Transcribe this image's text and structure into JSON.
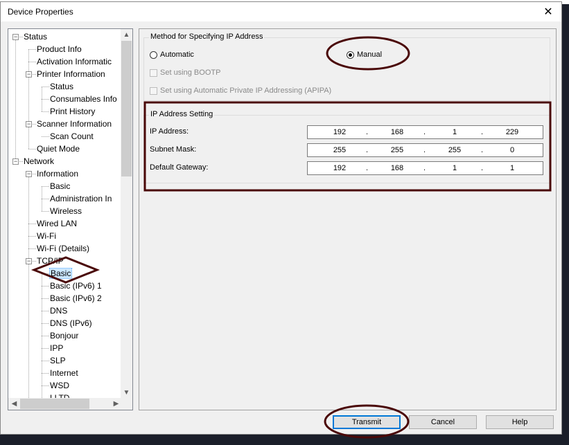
{
  "window": {
    "title": "Device Properties",
    "close_glyph": "✕"
  },
  "tree": {
    "items": [
      {
        "label": "Status",
        "level": 0,
        "expander": "⊟"
      },
      {
        "label": "Product Info",
        "level": 1
      },
      {
        "label": "Activation Informatic",
        "level": 1
      },
      {
        "label": "Printer Information",
        "level": 1,
        "expander": "⊟"
      },
      {
        "label": "Status",
        "level": 2
      },
      {
        "label": "Consumables Info",
        "level": 2
      },
      {
        "label": "Print History",
        "level": 2
      },
      {
        "label": "Scanner Information",
        "level": 1,
        "expander": "⊟"
      },
      {
        "label": "Scan Count",
        "level": 2
      },
      {
        "label": "Quiet Mode",
        "level": 1
      },
      {
        "label": "Network",
        "level": 0,
        "expander": "⊟"
      },
      {
        "label": "Information",
        "level": 1,
        "expander": "⊟"
      },
      {
        "label": "Basic",
        "level": 2
      },
      {
        "label": "Administration In",
        "level": 2
      },
      {
        "label": "Wireless",
        "level": 2
      },
      {
        "label": "Wired LAN",
        "level": 1
      },
      {
        "label": "Wi-Fi",
        "level": 1
      },
      {
        "label": "Wi-Fi (Details)",
        "level": 1
      },
      {
        "label": "TCP/IP",
        "level": 1,
        "expander": "⊟"
      },
      {
        "label": "Basic",
        "level": 2,
        "selected": true
      },
      {
        "label": "Basic (IPv6) 1",
        "level": 2
      },
      {
        "label": "Basic (IPv6) 2",
        "level": 2
      },
      {
        "label": "DNS",
        "level": 2
      },
      {
        "label": "DNS (IPv6)",
        "level": 2
      },
      {
        "label": "Bonjour",
        "level": 2
      },
      {
        "label": "IPP",
        "level": 2
      },
      {
        "label": "SLP",
        "level": 2
      },
      {
        "label": "Internet",
        "level": 2
      },
      {
        "label": "WSD",
        "level": 2
      },
      {
        "label": "LLTD",
        "level": 2
      }
    ]
  },
  "method": {
    "group_label": "Method for Specifying IP Address",
    "automatic_label": "Automatic",
    "manual_label": "Manual",
    "selected": "Manual",
    "bootp_label": "Set using BOOTP",
    "apipa_label": "Set using Automatic Private IP Addressing (APIPA)"
  },
  "ip_setting": {
    "group_label": "IP Address Setting",
    "fields": [
      {
        "label": "IP Address:",
        "octets": [
          "192",
          "168",
          "1",
          "229"
        ]
      },
      {
        "label": "Subnet Mask:",
        "octets": [
          "255",
          "255",
          "255",
          "0"
        ]
      },
      {
        "label": "Default Gateway:",
        "octets": [
          "192",
          "168",
          "1",
          "1"
        ]
      }
    ]
  },
  "buttons": {
    "transmit": "Transmit",
    "cancel": "Cancel",
    "help": "Help"
  },
  "colors": {
    "annotation": "#4a0808",
    "selection_outline": "#0078d7"
  },
  "icons": {
    "scroll_up": "▲",
    "scroll_down": "▼",
    "scroll_left": "◀",
    "scroll_right": "▶"
  }
}
